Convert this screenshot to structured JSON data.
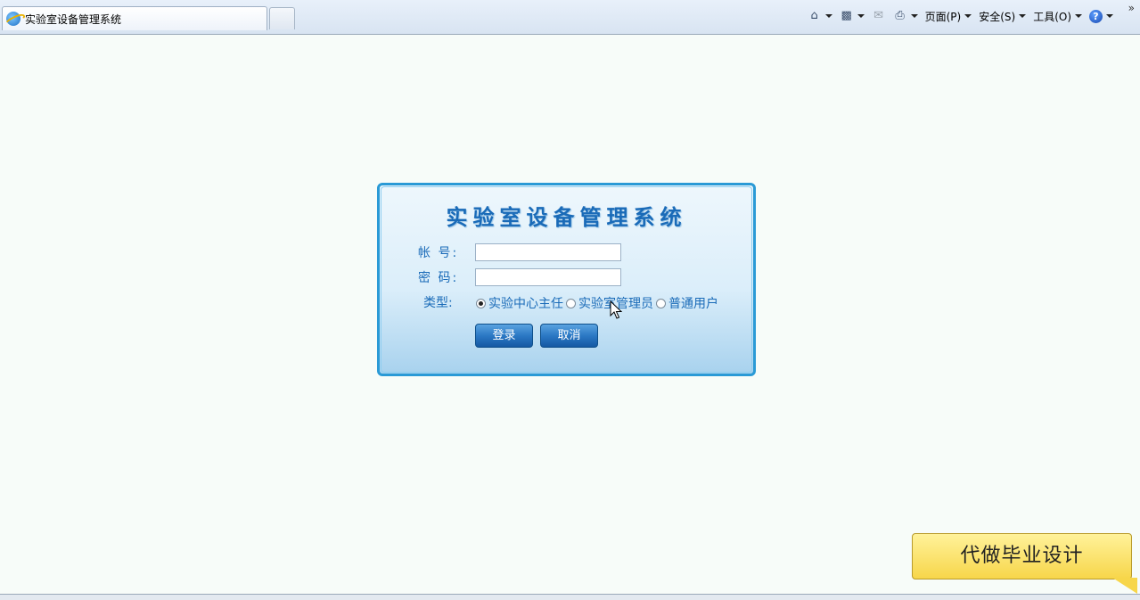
{
  "browser": {
    "tab_title": "实验室设备管理系统",
    "commands": {
      "page": "页面(P)",
      "safety": "安全(S)",
      "tools": "工具(O)"
    },
    "icons": [
      "home-icon",
      "feeds-icon",
      "mail-icon",
      "print-icon",
      "help-icon"
    ]
  },
  "login": {
    "title": "实验室设备管理系统",
    "account_label": "帐 号:",
    "account_value": "",
    "password_label": "密 码:",
    "password_value": "",
    "type_label": "类型:",
    "types": [
      {
        "label": "实验中心主任",
        "selected": true
      },
      {
        "label": "实验室管理员",
        "selected": false
      },
      {
        "label": "普通用户",
        "selected": false
      }
    ],
    "login_button": "登录",
    "cancel_button": "取消"
  },
  "ad": {
    "text": "代做毕业设计"
  },
  "colors": {
    "panel_border": "#2a9ad6",
    "label_text": "#1a6bb8",
    "button": "#2b78c4",
    "ad_bg": "#f7d64a"
  }
}
